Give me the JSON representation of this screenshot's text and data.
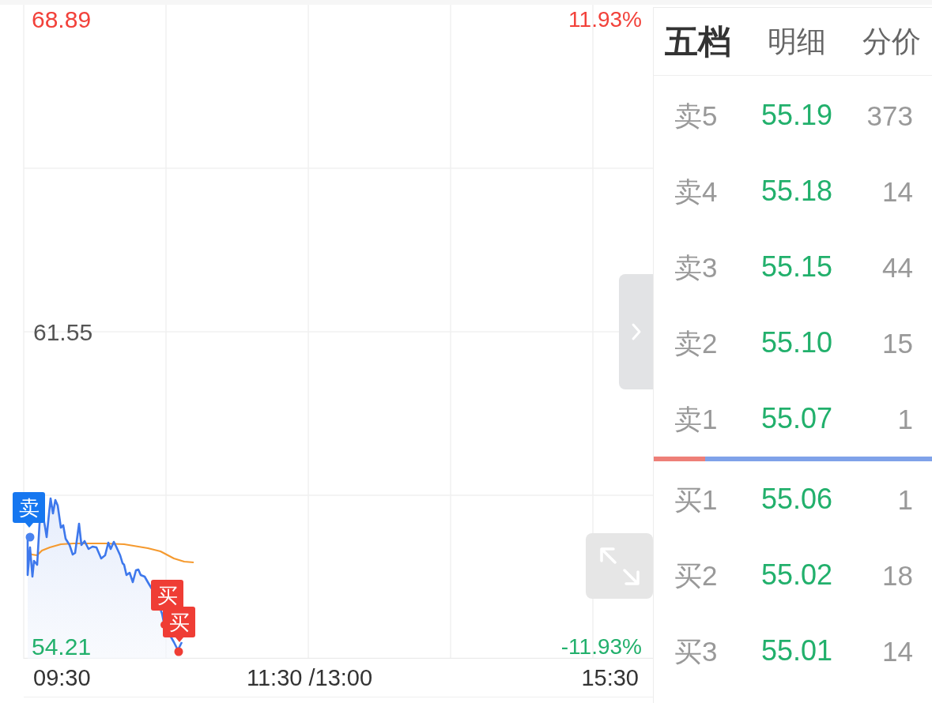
{
  "chart": {
    "y_labels": [
      {
        "text": "68.89",
        "kind": "high"
      },
      {
        "text": "61.55",
        "kind": "base"
      },
      {
        "text": "54.21",
        "kind": "low"
      }
    ],
    "pct_labels": [
      {
        "text": "11.93%",
        "kind": "up"
      },
      {
        "text": "-11.93%",
        "kind": "down"
      }
    ],
    "time_labels": [
      "09:30",
      "11:30 /13:00",
      "15:30"
    ],
    "markers": [
      {
        "label": "卖",
        "kind": "sell"
      },
      {
        "label": "买",
        "kind": "buy"
      },
      {
        "label": "买",
        "kind": "buy"
      }
    ]
  },
  "tabs": [
    {
      "label": "五档",
      "selected": true
    },
    {
      "label": "明细",
      "selected": false
    },
    {
      "label": "分价",
      "selected": false
    }
  ],
  "order_book": {
    "asks": [
      {
        "label": "卖5",
        "price": "55.19",
        "volume": "373"
      },
      {
        "label": "卖4",
        "price": "55.18",
        "volume": "14"
      },
      {
        "label": "卖3",
        "price": "55.15",
        "volume": "44"
      },
      {
        "label": "卖2",
        "price": "55.10",
        "volume": "15"
      },
      {
        "label": "卖1",
        "price": "55.07",
        "volume": "1"
      }
    ],
    "ratio": {
      "level": 0.185
    },
    "bids": [
      {
        "label": "买1",
        "price": "55.06",
        "volume": "1"
      },
      {
        "label": "买2",
        "price": "55.02",
        "volume": "18"
      },
      {
        "label": "买3",
        "price": "55.01",
        "volume": "14"
      }
    ]
  }
}
